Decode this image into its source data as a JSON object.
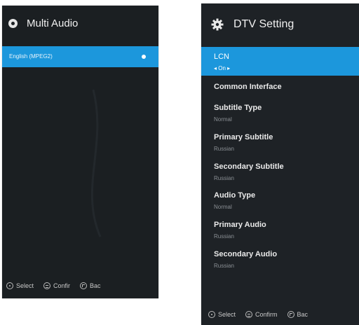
{
  "multi_audio": {
    "title": "Multi Audio",
    "selected_track": "English (MPEG2)",
    "hints": {
      "select": "Select",
      "confirm": "Confir",
      "back": "Bac"
    }
  },
  "dtv_setting": {
    "title": "DTV Setting",
    "items": [
      {
        "label": "LCN",
        "value": "On"
      },
      {
        "label": "Common Interface"
      },
      {
        "label": "Subtitle Type",
        "value": "Normal"
      },
      {
        "label": "Primary Subtitle",
        "value": "Russian"
      },
      {
        "label": "Secondary Subtitle",
        "value": "Russian"
      },
      {
        "label": "Audio Type",
        "value": "Normal"
      },
      {
        "label": "Primary Audio",
        "value": "Russian"
      },
      {
        "label": "Secondary Audio",
        "value": "Russian"
      }
    ],
    "hints": {
      "select": "Select",
      "confirm": "Confirm",
      "back": "Bac"
    }
  },
  "colors": {
    "highlight": "#1c97dc",
    "panel_bg": "#1b1f22",
    "muted_text": "#8a8f94"
  }
}
